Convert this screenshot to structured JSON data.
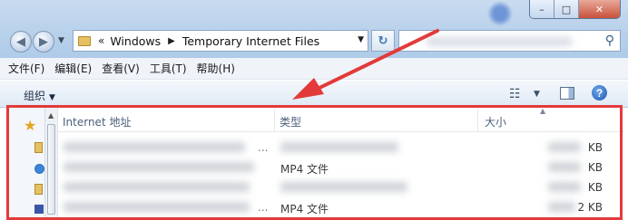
{
  "window": {
    "buttons": {
      "minimize": "–",
      "maximize": "□",
      "close": "✕"
    }
  },
  "nav": {
    "back_icon": "back-arrow-icon",
    "forward_icon": "forward-arrow-icon",
    "breadcrumb": [
      "Windows",
      "Temporary Internet Files"
    ],
    "overflow_chevron": "«",
    "separator": "▶",
    "dropdown": "▼",
    "refresh_glyph": "↻"
  },
  "menu": {
    "items": [
      "文件(F)",
      "编辑(E)",
      "查看(V)",
      "工具(T)",
      "帮助(H)"
    ]
  },
  "command_bar": {
    "organize_label": "组织",
    "organize_dd": "▼",
    "views_dd": "▼",
    "help_glyph": "?"
  },
  "list": {
    "columns": [
      "Internet 地址",
      "类型",
      "大小"
    ],
    "sort_glyph": "▲",
    "rows": [
      {
        "type": "",
        "size": "KB",
        "dots": "..."
      },
      {
        "type": "MP4 文件",
        "size": "KB",
        "dots": ""
      },
      {
        "type": "",
        "size": "KB",
        "dots": ""
      },
      {
        "type": "MP4 文件",
        "size": "2 KB",
        "dots": "..."
      }
    ]
  },
  "colors": {
    "annotation": "#e23a3a",
    "accent": "#3a73b8"
  }
}
